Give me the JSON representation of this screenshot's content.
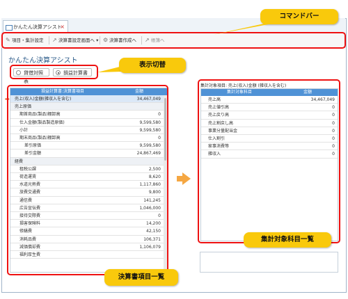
{
  "window": {
    "tab_title": "かんたん決算アシスト",
    "tab_close": "×"
  },
  "toolbar": {
    "items": [
      {
        "label": "項目・集計設定",
        "icon": "pencil-icon",
        "enabled": true
      },
      {
        "label": "決算書設定画面へ ▾",
        "icon": "arrow-icon",
        "enabled": true
      },
      {
        "label": "決算書作成へ",
        "icon": "gear-icon",
        "enabled": true
      },
      {
        "label": "帳簿へ",
        "icon": "arrow-icon",
        "enabled": false
      }
    ]
  },
  "callouts": {
    "command_bar": "コマンドバー",
    "display_switch": "表示切替",
    "aggregate_list": "集計対象科目一覧",
    "statement_list": "決算書項目一覧"
  },
  "app": {
    "title": "かんたん決算アシスト"
  },
  "view_switch": {
    "options": [
      {
        "label": "貸借対照表",
        "selected": false
      },
      {
        "label": "損益計算書",
        "selected": true
      }
    ]
  },
  "left_table": {
    "headers": [
      "損益計算書:決算書項目",
      "金額"
    ],
    "rows": [
      {
        "label": "売上(収入)金額(雑収入を含む)",
        "value": "34,467,049",
        "type": "selected",
        "indent": 0
      },
      {
        "label": "売上原価",
        "value": "",
        "type": "section",
        "indent": 0
      },
      {
        "label": "期首商品(製品)棚卸高",
        "value": "0",
        "type": "item",
        "indent": 1
      },
      {
        "label": "仕入金額(製品製造原価)",
        "value": "9,599,580",
        "type": "item",
        "indent": 1
      },
      {
        "label": "小計",
        "value": "9,599,580",
        "type": "item",
        "indent": 1
      },
      {
        "label": "期末商品(製品)棚卸高",
        "value": "0",
        "type": "item",
        "indent": 1
      },
      {
        "label": "差引原価",
        "value": "9,599,580",
        "type": "item",
        "indent": 2
      },
      {
        "label": "差引金額",
        "value": "24,867,469",
        "type": "item",
        "indent": 2
      },
      {
        "label": "経費",
        "value": "",
        "type": "section",
        "indent": 0
      },
      {
        "label": "租税公課",
        "value": "2,500",
        "type": "item",
        "indent": 1
      },
      {
        "label": "荷造運賃",
        "value": "8,620",
        "type": "item",
        "indent": 1
      },
      {
        "label": "水道光熱費",
        "value": "1,117,860",
        "type": "item",
        "indent": 1
      },
      {
        "label": "旅費交通費",
        "value": "9,800",
        "type": "item",
        "indent": 1
      },
      {
        "label": "通信費",
        "value": "141,245",
        "type": "item",
        "indent": 1
      },
      {
        "label": "広告宣伝費",
        "value": "1,046,000",
        "type": "item",
        "indent": 1
      },
      {
        "label": "接待交際費",
        "value": "0",
        "type": "item",
        "indent": 1
      },
      {
        "label": "損害保険料",
        "value": "14,200",
        "type": "item",
        "indent": 1
      },
      {
        "label": "修繕費",
        "value": "42,150",
        "type": "item",
        "indent": 1
      },
      {
        "label": "消耗品費",
        "value": "106,371",
        "type": "item",
        "indent": 1
      },
      {
        "label": "減価償却費",
        "value": "1,106,079",
        "type": "item",
        "indent": 1
      },
      {
        "label": "福利厚生費",
        "value": "",
        "type": "item",
        "indent": 1
      }
    ]
  },
  "right_panel": {
    "caption": "集計対象項目: 売上(収入)金額 (雑収入を含む)",
    "headers": [
      "集計対象科目",
      "金額"
    ],
    "rows": [
      {
        "label": "売上高",
        "value": "34,467,049"
      },
      {
        "label": "売上値引高",
        "value": "0"
      },
      {
        "label": "売上戻り高",
        "value": "0"
      },
      {
        "label": "売上割戻し高",
        "value": "0"
      },
      {
        "label": "事業分量配当金",
        "value": "0"
      },
      {
        "label": "仕入割引",
        "value": "0"
      },
      {
        "label": "家事消費等",
        "value": "0"
      },
      {
        "label": "雑収入",
        "value": "0"
      }
    ]
  },
  "colors": {
    "header_blue": "#4f92d6",
    "highlight_red": "#ee1111",
    "callout_yellow": "#f9c90c",
    "arrow_orange": "#f5a742"
  }
}
